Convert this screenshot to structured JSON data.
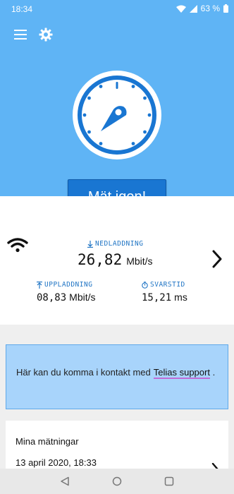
{
  "status_bar": {
    "time": "18:34",
    "battery": "63 %"
  },
  "header": {
    "menu_icon": "hamburger-menu-icon",
    "settings_icon": "gear-icon"
  },
  "gauge": {
    "icon": "speedometer-gauge-icon"
  },
  "measure_button": {
    "label": "Mät igen!"
  },
  "results": {
    "connection_icon": "wifi-icon",
    "download": {
      "label": "NEDLADDNING",
      "value": "26,82",
      "unit": "Mbit/s"
    },
    "upload": {
      "label": "UPPLADDNING",
      "value": "08,83",
      "unit": "Mbit/s"
    },
    "latency": {
      "label": "SVARSTID",
      "value": "15,21",
      "unit": "ms"
    },
    "details_icon": "chevron-right-icon"
  },
  "contact": {
    "text": "Här kan du komma i kontakt med",
    "link": "Telias support",
    "suffix": "."
  },
  "history": {
    "title": "Mina mätningar",
    "latest_date": "13 april 2020, 18:33"
  },
  "nav": {
    "back": "back-triangle-icon",
    "home": "home-circle-icon",
    "recents": "recents-square-icon"
  },
  "colors": {
    "hero": "#5fb4f5",
    "accent": "#1976d2",
    "contact_bg": "#a8d4fb",
    "link_underline": "#c06bd6"
  }
}
